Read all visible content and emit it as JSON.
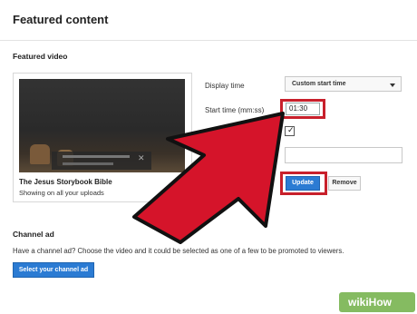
{
  "header": {
    "title": "Featured content"
  },
  "featured_video": {
    "section_title": "Featured video",
    "video_title": "The Jesus Storybook Bible",
    "video_subtitle": "Showing on all your uploads"
  },
  "settings": {
    "display_time_label": "Display time",
    "display_time_value": "Custom start time",
    "start_time_label": "Start time (mm:ss)",
    "start_time_value": "01:30",
    "checkbox_checked": true,
    "update_label": "Update",
    "remove_label": "Remove"
  },
  "channel_ad": {
    "section_title": "Channel ad",
    "description": "Have a channel ad? Choose the video and it could be selected as one of a few to be promoted to viewers.",
    "button_label": "Select your channel ad"
  },
  "colors": {
    "accent_blue": "#2b7bd3",
    "highlight_red": "#c8202b",
    "arrow_red": "#d5142a"
  },
  "watermark": "wikiHow"
}
